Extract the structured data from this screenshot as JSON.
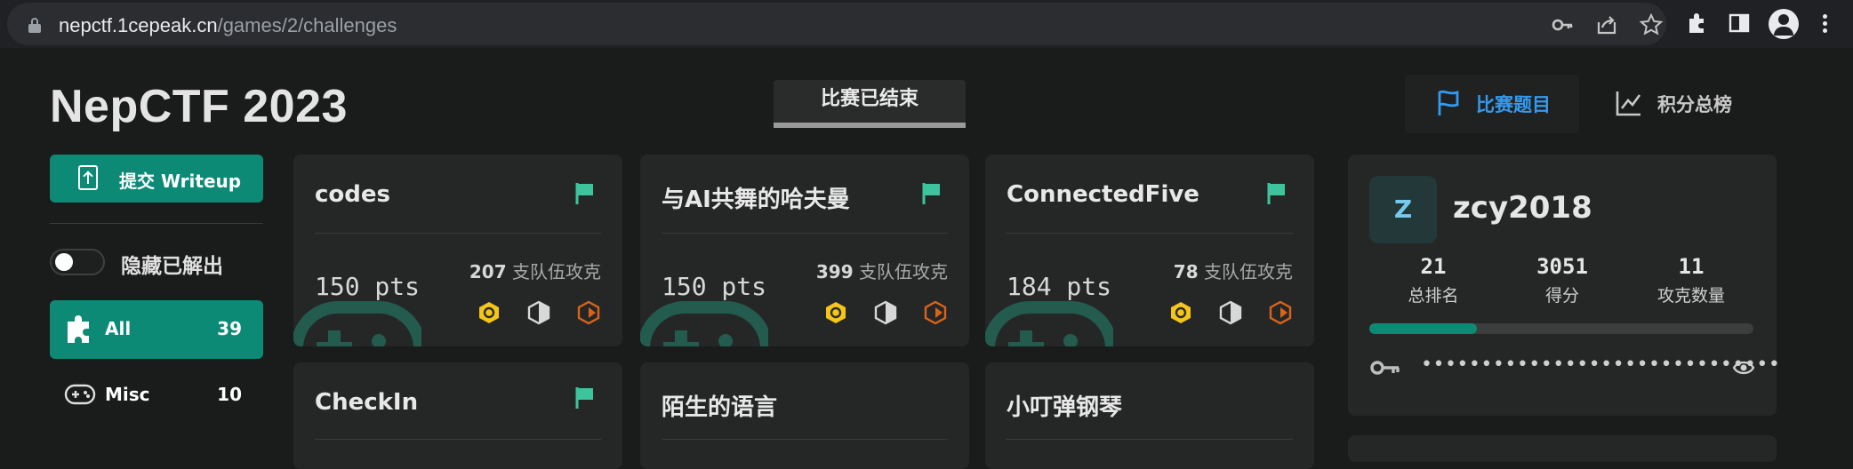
{
  "browser": {
    "url_host": "nepctf.1cepeak.cn",
    "url_path": "/games/2/challenges"
  },
  "header": {
    "site_title": "NepCTF 2023",
    "status_tab": "比赛已结束",
    "nav_challenges": "比赛题目",
    "nav_scoreboard": "积分总榜",
    "accent_color": "#339af0"
  },
  "sidebar": {
    "writeup_button": "提交 Writeup",
    "hide_solved_label": "隐藏已解出",
    "hide_solved_on": false,
    "categories": [
      {
        "name": "All",
        "count": "39",
        "active": true
      },
      {
        "name": "Misc",
        "count": "10",
        "active": false
      }
    ]
  },
  "challenges": [
    {
      "title": "codes",
      "points": "150 pts",
      "solves": "207",
      "solves_unit": "支队伍攻克"
    },
    {
      "title": "与AI共舞的哈夫曼",
      "points": "150 pts",
      "solves": "399",
      "solves_unit": "支队伍攻克"
    },
    {
      "title": "ConnectedFive",
      "points": "184 pts",
      "solves": "78",
      "solves_unit": "支队伍攻克"
    },
    {
      "title": "CheckIn"
    },
    {
      "title": "陌生的语言"
    },
    {
      "title": "小叮弹钢琴"
    }
  ],
  "profile": {
    "avatar_letter": "Z",
    "username": "zcy2018",
    "rank": "21",
    "rank_label": "总排名",
    "score": "3051",
    "score_label": "得分",
    "solved": "11",
    "solved_label": "攻克数量",
    "progress_fraction": 0.28,
    "token_masked": "••••••••••••••••••••••••••••••"
  }
}
